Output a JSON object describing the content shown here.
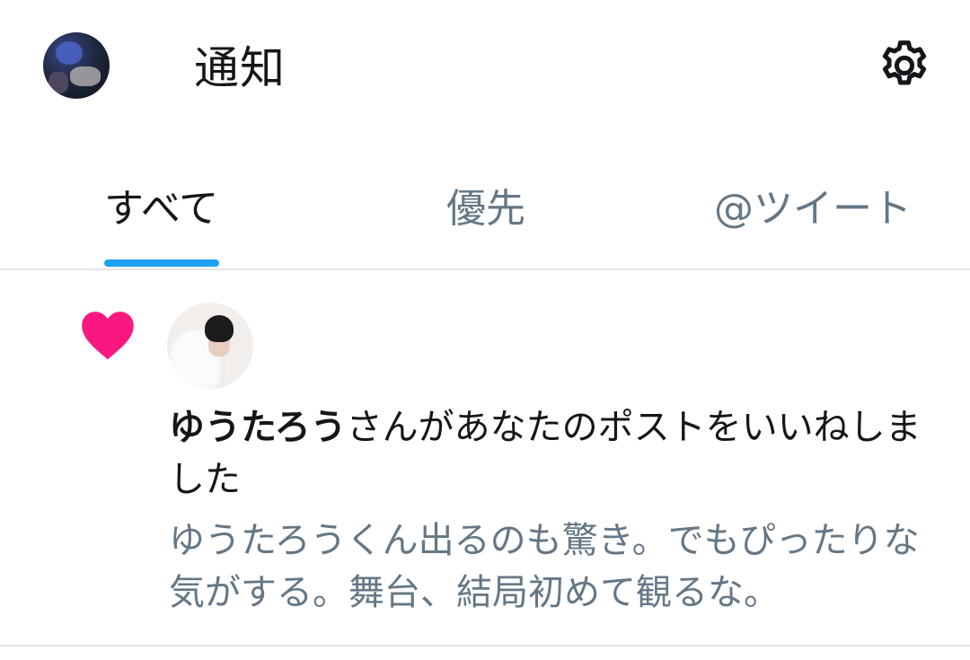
{
  "header": {
    "title": "通知",
    "avatar_icon": "profile-avatar",
    "settings_icon": "gear-icon"
  },
  "tabs": [
    {
      "label": "すべて",
      "active": true
    },
    {
      "label": "優先",
      "active": false
    },
    {
      "label": "@ツイート",
      "active": false
    }
  ],
  "notification": {
    "type_icon": "heart-icon",
    "username": "ゆうたろう",
    "action_text": "さんがあなたのポストをいいねしました",
    "tweet_preview": "ゆうたろうくん出るのも驚き。でもぴったりな気がする。舞台、結局初めて観るな。"
  },
  "colors": {
    "accent": "#1da1f2",
    "like": "#f91880",
    "text_primary": "#14171a",
    "text_secondary": "#657786",
    "divider": "#e1e8ed"
  }
}
